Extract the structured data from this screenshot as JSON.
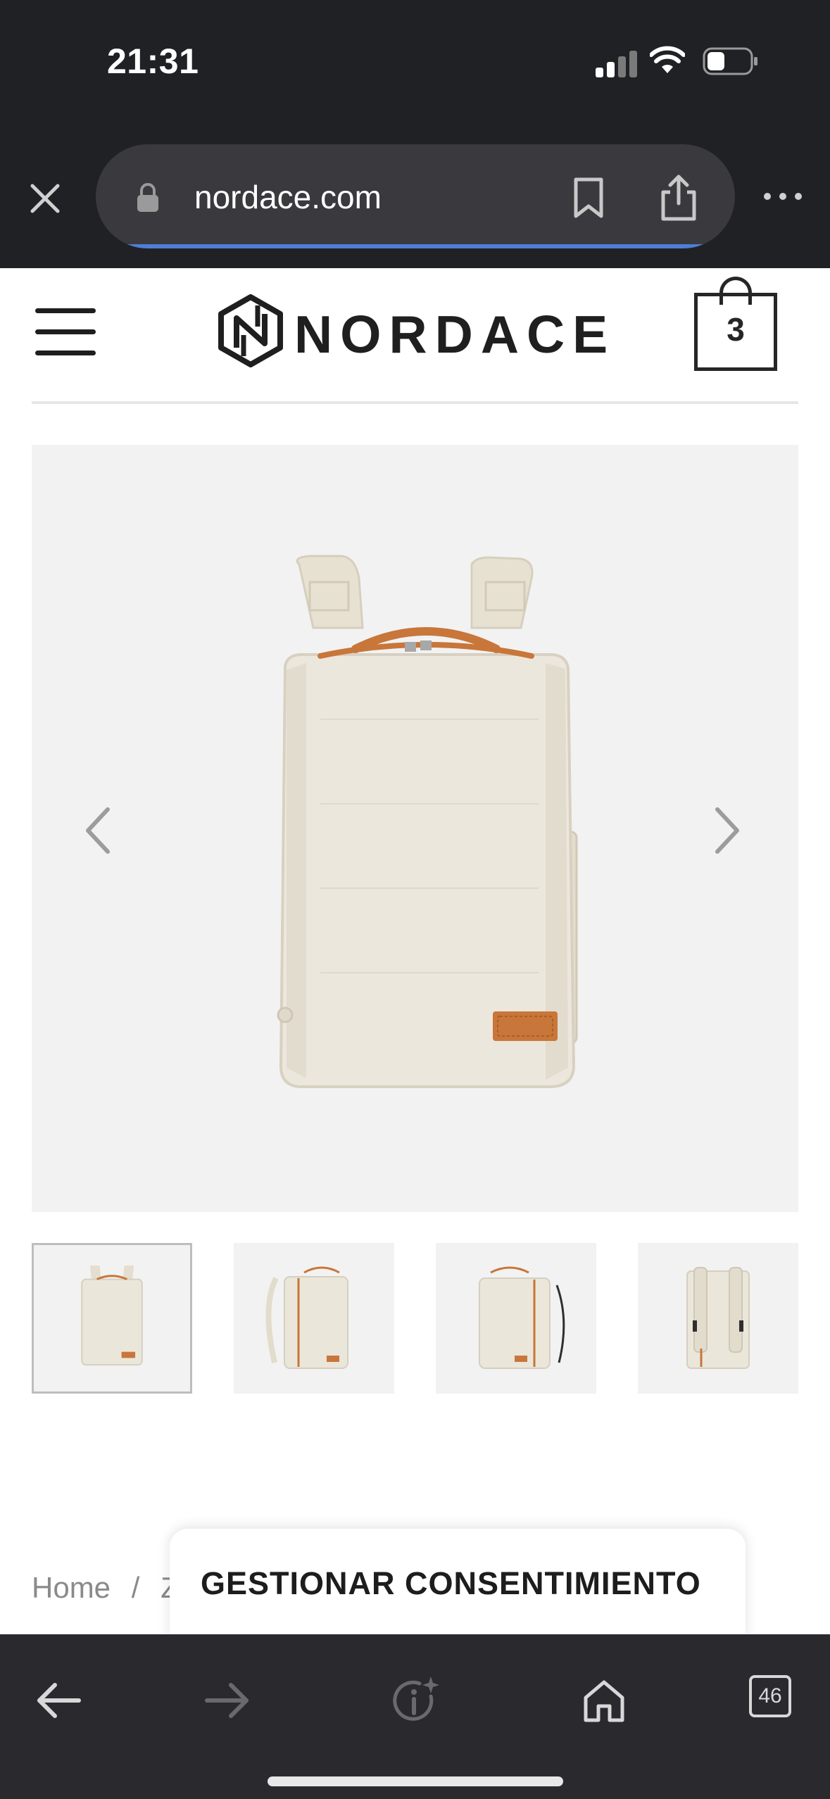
{
  "status_bar": {
    "time": "21:31",
    "battery_level": 0.35
  },
  "browser": {
    "url": "nordace.com",
    "open_tabs": "46"
  },
  "site": {
    "brand": "NORDACE",
    "cart_count": "3"
  },
  "breadcrumb": {
    "home": "Home",
    "separator": "/",
    "partial": "Z"
  },
  "consent": {
    "title": "GESTIONAR CONSENTIMIENTO"
  },
  "colors": {
    "chrome_dark": "#202125",
    "url_bar": "#3a3a3e",
    "load_progress": "#4f7ed6",
    "gallery_bg": "#f2f2f2",
    "bag_canvas": "#e9e4d8",
    "leather_accent": "#c8763a"
  },
  "icons": [
    "close-icon",
    "lock-icon",
    "bookmark-icon",
    "share-icon",
    "more-icon",
    "hamburger-menu-icon",
    "cart-icon",
    "chevron-left-icon",
    "chevron-right-icon",
    "back-arrow-icon",
    "forward-arrow-icon",
    "info-sparkle-icon",
    "home-icon",
    "tabs-icon"
  ]
}
